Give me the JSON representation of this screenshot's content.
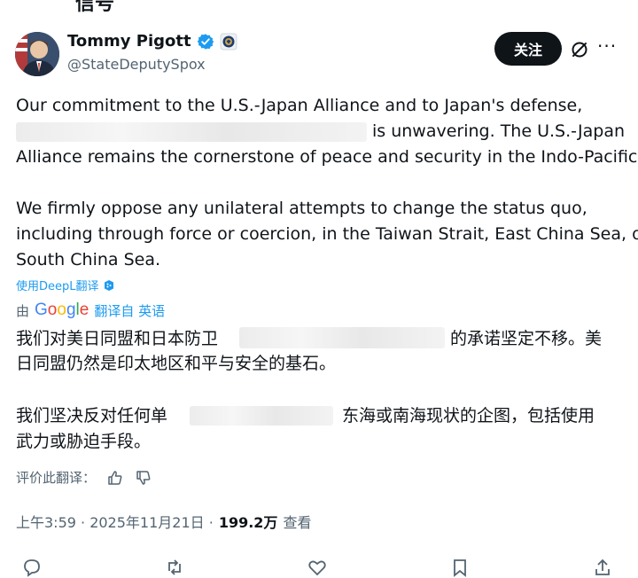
{
  "cut_title": "信号",
  "author": {
    "name": "Tommy Pigott",
    "handle": "@StateDeputySpox"
  },
  "follow_label": "关注",
  "more_label": "···",
  "tweet": {
    "line1": "Our commitment to the U.S.-Japan Alliance and to Japan's defense,",
    "line2": "is unwavering. The U.S.-Japan",
    "line3": "Alliance remains the cornerstone of peace and security in the Indo-Pacific.",
    "line4": "We firmly oppose any unilateral attempts to change the status quo,",
    "line5": "including through force or coercion, in the Taiwan Strait, East China Sea, or",
    "line6": "South China Sea."
  },
  "deepl_label": "使用DeepL翻译",
  "google": {
    "prefix": "由",
    "logo": "Google",
    "action": "翻译自 英语"
  },
  "translation": {
    "line1a": "我们对美日同盟和日本防卫",
    "line1b": "的承诺坚定不移。美",
    "line2": "日同盟仍然是印太地区和平与安全的基石。",
    "line3a": "我们坚决反对任何单",
    "line3b": "东海或南海现状的企图，包括使用",
    "line4": "武力或胁迫手段。"
  },
  "rate_label": "评价此翻译：",
  "meta": {
    "time": "上午3:59 · 2025年11月21日 ·",
    "views": "199.2万",
    "views_label": "查看"
  },
  "colors": {
    "text": "#0f1419",
    "secondary": "#536471",
    "link": "#1d9bf0",
    "verified": "#1d9bf0"
  },
  "icons": [
    "verified-badge-icon",
    "state-seal-icon",
    "grok-icon",
    "deepl-badge-icon",
    "thumbs-up-icon",
    "thumbs-down-icon",
    "reply-icon",
    "repost-icon",
    "like-icon",
    "bookmark-icon",
    "share-icon"
  ]
}
